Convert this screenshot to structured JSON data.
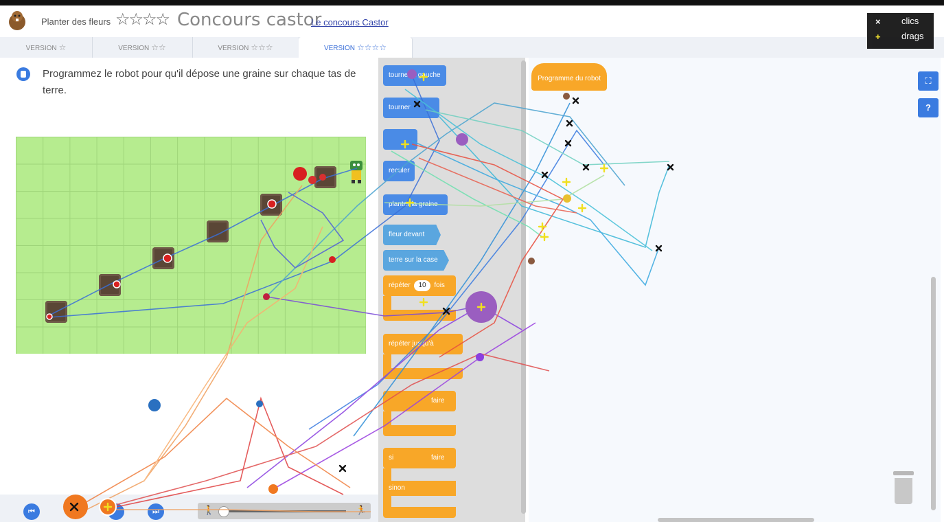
{
  "header": {
    "task_title": "Planter des fleurs",
    "stars_big": "☆☆☆☆",
    "contest_title": "Concours castor",
    "contest_link": "Le concours Castor"
  },
  "tabs": [
    {
      "label": "VERSION",
      "stars": "☆"
    },
    {
      "label": "VERSION",
      "stars": "☆☆"
    },
    {
      "label": "VERSION",
      "stars": "☆☆☆"
    },
    {
      "label": "VERSION",
      "stars": "☆☆☆☆"
    }
  ],
  "instructions": "Programmez le robot pour qu'il dépose une graine sur chaque tas de terre.",
  "palette": {
    "blocks": [
      {
        "label": "tourner à gauche",
        "kind": "blue"
      },
      {
        "label": "tourner",
        "kind": "blue"
      },
      {
        "label": "",
        "kind": "blue"
      },
      {
        "label": "reculer",
        "kind": "blue"
      },
      {
        "label": "planter la graine",
        "kind": "blue"
      },
      {
        "label": "fleur devant",
        "kind": "teal"
      },
      {
        "label": "terre sur la case",
        "kind": "teal"
      },
      {
        "label": "répéter",
        "kind": "orange",
        "value": "10",
        "suffix": "fois"
      },
      {
        "label": "répéter jusqu'à",
        "kind": "orange"
      },
      {
        "label": "faire",
        "kind": "orange"
      },
      {
        "label": "si",
        "kind": "orange",
        "suffix": "faire"
      },
      {
        "label": "sinon",
        "kind": "orange"
      }
    ]
  },
  "workspace": {
    "hat_block": "Programme du robot",
    "fullscreen_icon": "⛶",
    "help_label": "?"
  },
  "legend": {
    "clicks_symbol": "×",
    "clicks_label": "clics",
    "drags_symbol": "+",
    "drags_label": "drags"
  },
  "controls": {
    "rewind_icon": "⏮",
    "forward_icon": "⏭"
  },
  "colors": {
    "accent": "#3a7be0",
    "grid_green": "#b6ec8f",
    "block_orange": "#f8a728",
    "block_blue": "#4a8be6"
  }
}
